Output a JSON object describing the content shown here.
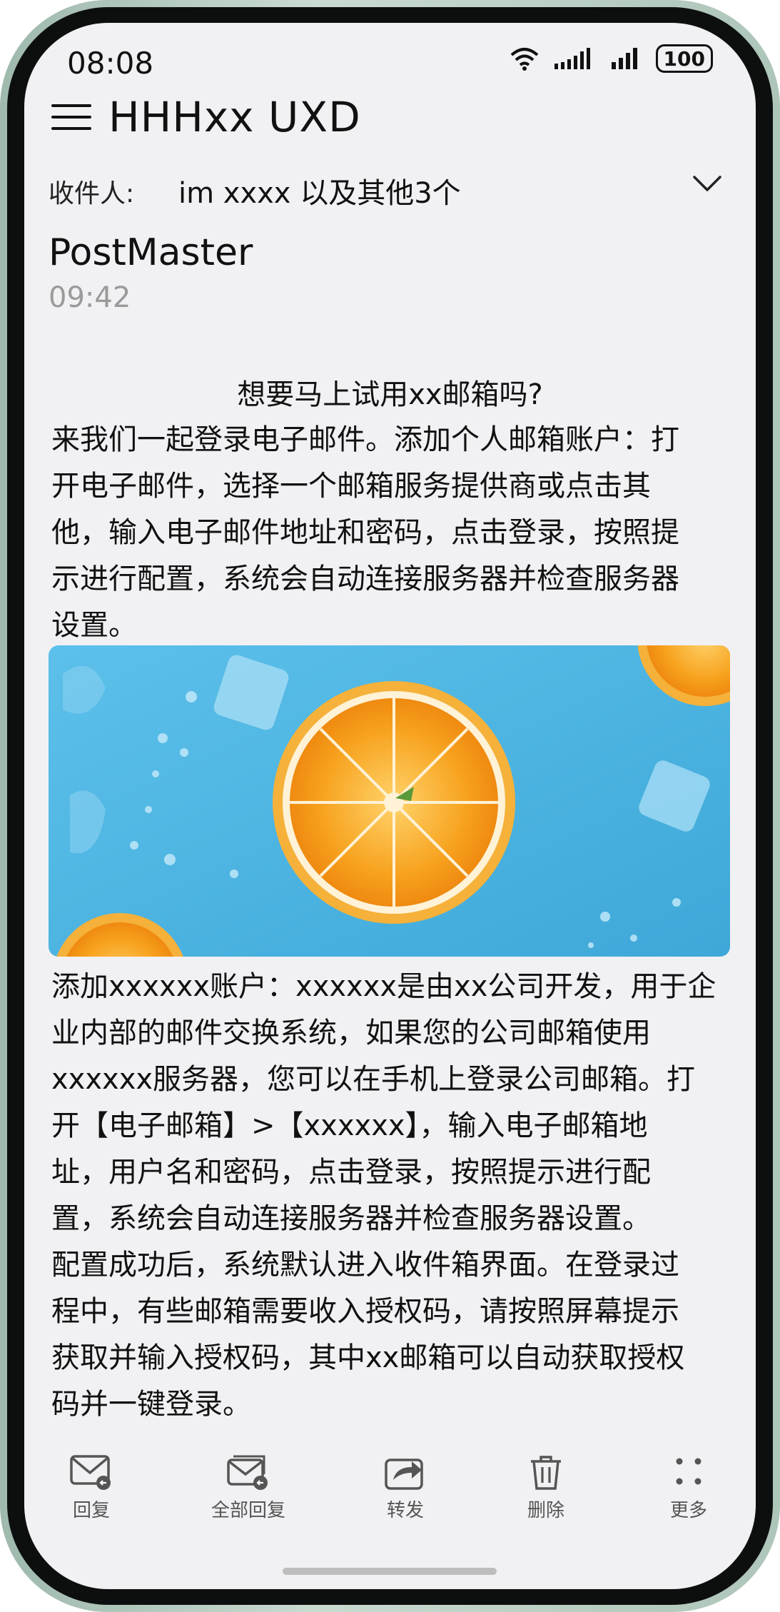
{
  "status_bar": {
    "time": "08:08",
    "battery": "100"
  },
  "header": {
    "title": "HHHxx UXD"
  },
  "recipients": {
    "label": "收件人:",
    "value": "im xxxx 以及其他3个"
  },
  "message": {
    "sender": "PostMaster",
    "time": "09:42",
    "subject": "想要马上试用xx邮箱吗?",
    "paragraph1_lines": [
      "来我们一起登录电子邮件。添加个人邮箱账户：打",
      "开电子邮件，选择一个邮箱服务提供商或点击其",
      "他，输入电子邮件地址和密码，点击登录，按照提",
      "示进行配置，系统会自动连接服务器并检查服务器",
      "设置。"
    ],
    "paragraph2_lines": [
      "添加xxxxxx账户：xxxxxx是由xx公司开发，用于企",
      "业内部的邮件交换系统，如果您的公司邮箱使用",
      "xxxxxx服务器，您可以在手机上登录公司邮箱。打",
      "开【电子邮箱】>【xxxxxx】，输入电子邮箱地",
      "址，用户名和密码，点击登录，按照提示进行配",
      "置，系统会自动连接服务器并检查服务器设置。",
      "配置成功后，系统默认进入收件箱界面。在登录过",
      "程中，有些邮箱需要收入授权码，请按照屏幕提示",
      "获取并输入授权码，其中xx邮箱可以自动获取授权",
      "码并一键登录。"
    ]
  },
  "toolbar": {
    "reply": "回复",
    "reply_all": "全部回复",
    "forward": "转发",
    "delete": "删除",
    "more": "更多"
  },
  "colors": {
    "screen_bg": "#f1f1f4",
    "image_bg": "#4fb6e3",
    "orange": "#f59a1c"
  }
}
